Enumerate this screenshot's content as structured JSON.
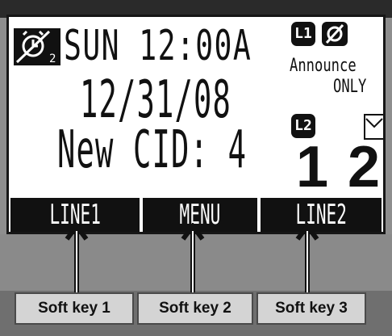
{
  "display": {
    "day_time": "SUN 12:00A",
    "date": "12/31/08",
    "caller_id_status": "New CID: 4",
    "alarm_icon_subscript": "2",
    "line1_badge": "L1",
    "line2_badge": "L2",
    "announce_text": "Announce",
    "only_text": "ONLY",
    "message_count": "12"
  },
  "softkey_labels": [
    "LINE1",
    "MENU",
    "LINE2"
  ],
  "softkeys": [
    "Soft key 1",
    "Soft key 2",
    "Soft key 3"
  ],
  "icons": [
    "alarm-clock-icon",
    "mute-icon",
    "mail-icon",
    "up-arrow-icon"
  ]
}
